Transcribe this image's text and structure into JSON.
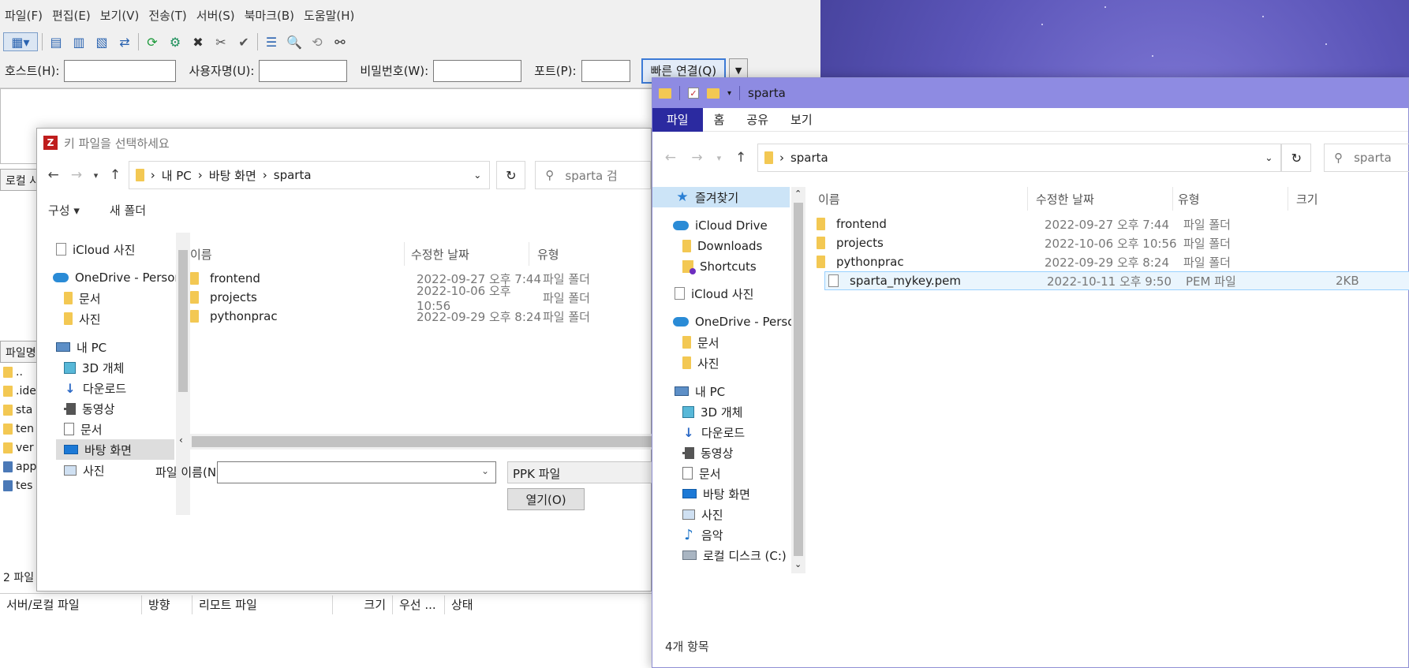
{
  "filezilla": {
    "menu": [
      "파일(F)",
      "편집(E)",
      "보기(V)",
      "전송(T)",
      "서버(S)",
      "북마크(B)",
      "도움말(H)"
    ],
    "quickconnect": {
      "host_label": "호스트(H):",
      "user_label": "사용자명(U):",
      "pass_label": "비밀번호(W):",
      "port_label": "포트(P):",
      "connect_label": "빠른 연결(Q)"
    },
    "left_strip": {
      "local_tab": "로컬 사",
      "filename_tab": "파일명",
      "rows": [
        "..",
        ".ide",
        "sta",
        "ten",
        "ver",
        "app",
        "tes"
      ],
      "status": "2 파일"
    },
    "queue_headers": [
      "서버/로컬 파일",
      "방향",
      "리모트 파일",
      "크기",
      "우선 ...",
      "상태"
    ]
  },
  "keyfile_dialog": {
    "title": "키 파일을 선택하세요",
    "breadcrumb": [
      "내 PC",
      "바탕 화면",
      "sparta"
    ],
    "search_placeholder": "sparta 검",
    "organize": "구성 ▾",
    "new_folder": "새 폴더",
    "nav": [
      "iCloud 사진",
      "OneDrive - Personal",
      "문서",
      "사진",
      "내 PC",
      "3D 개체",
      "다운로드",
      "동영상",
      "문서",
      "바탕 화면",
      "사진"
    ],
    "columns": [
      "이름",
      "수정한 날짜",
      "유형"
    ],
    "files": [
      {
        "name": "frontend",
        "date": "2022-09-27 오후 7:44",
        "type": "파일 폴더"
      },
      {
        "name": "projects",
        "date": "2022-10-06 오후 10:56",
        "type": "파일 폴더"
      },
      {
        "name": "pythonprac",
        "date": "2022-09-29 오후 8:24",
        "type": "파일 폴더"
      }
    ],
    "filename_label": "파일 이름(N):",
    "filetype": "PPK 파일",
    "open_label": "열기(O)"
  },
  "explorer": {
    "title": "sparta",
    "ribbon_tabs": [
      "파일",
      "홈",
      "공유",
      "보기"
    ],
    "address": "sparta",
    "search_placeholder": "sparta",
    "nav": [
      {
        "label": "즐겨찾기",
        "icon": "star-icon"
      },
      {
        "label": "iCloud Drive",
        "icon": "cloud-icon"
      },
      {
        "label": "Downloads",
        "icon": "folder-icon"
      },
      {
        "label": "Shortcuts",
        "icon": "shortcut-folder-icon"
      },
      {
        "label": "iCloud 사진",
        "icon": "file-icon"
      },
      {
        "label": "OneDrive - Personal",
        "icon": "cloud-icon"
      },
      {
        "label": "문서",
        "icon": "folder-icon"
      },
      {
        "label": "사진",
        "icon": "folder-icon"
      },
      {
        "label": "내 PC",
        "icon": "pc-icon"
      },
      {
        "label": "3D 개체",
        "icon": "cube-icon"
      },
      {
        "label": "다운로드",
        "icon": "download-icon"
      },
      {
        "label": "동영상",
        "icon": "film-icon"
      },
      {
        "label": "문서",
        "icon": "document-icon"
      },
      {
        "label": "바탕 화면",
        "icon": "desktop-icon"
      },
      {
        "label": "사진",
        "icon": "picture-icon"
      },
      {
        "label": "음악",
        "icon": "music-icon"
      },
      {
        "label": "로컬 디스크 (C:)",
        "icon": "disk-icon"
      }
    ],
    "columns": [
      "이름",
      "수정한 날짜",
      "유형",
      "크기"
    ],
    "files": [
      {
        "name": "frontend",
        "date": "2022-09-27 오후 7:44",
        "type": "파일 폴더",
        "size": ""
      },
      {
        "name": "projects",
        "date": "2022-10-06 오후 10:56",
        "type": "파일 폴더",
        "size": ""
      },
      {
        "name": "pythonprac",
        "date": "2022-09-29 오후 8:24",
        "type": "파일 폴더",
        "size": ""
      },
      {
        "name": "sparta_mykey.pem",
        "date": "2022-10-11 오후 9:50",
        "type": "PEM 파일",
        "size": "2KB"
      }
    ],
    "status": "4개 항목"
  },
  "colors": {
    "explorer_titlebar": "#8e8be2",
    "ribbon_file_tab": "#2b2aa0",
    "folder": "#f3c853",
    "selection": "#cce4f7"
  }
}
